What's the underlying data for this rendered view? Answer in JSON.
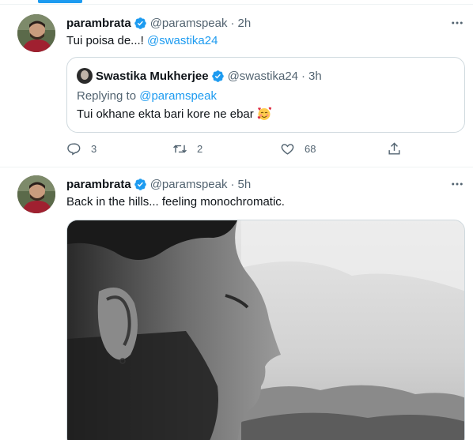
{
  "tweets": [
    {
      "name": "parambrata",
      "handle": "@paramspeak",
      "separator": "·",
      "time": "2h",
      "text": "Tui poisa de...! ",
      "mention": "@swastika24",
      "quote": {
        "name": "Swastika Mukherjee",
        "handle": "@swastika24",
        "separator": "·",
        "time": "3h",
        "replying_prefix": "Replying to ",
        "replying_to": "@paramspeak",
        "text": "Tui okhane ekta bari kore ne ebar",
        "emoji": "smiling-face-with-hearts-emoji"
      },
      "actions": {
        "replies": "3",
        "retweets": "2",
        "likes": "68"
      }
    },
    {
      "name": "parambrata",
      "handle": "@paramspeak",
      "separator": "·",
      "time": "5h",
      "text": "Back in the hills... feeling monochromatic.",
      "media": "black-and-white-profile-photo-mountains"
    }
  ],
  "colors": {
    "accent": "#1d9bf0",
    "secondary_text": "#536471",
    "border": "#cfd9de"
  }
}
